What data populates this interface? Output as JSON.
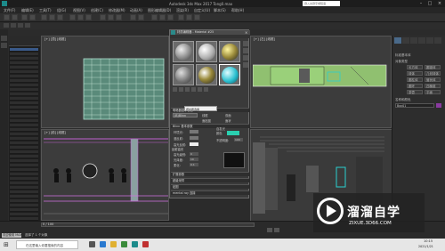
{
  "window": {
    "title": "Autodesk 3ds Max 2017    Tong0.max",
    "search_placeholder": "键入关键字或短语"
  },
  "menubar": {
    "items": [
      "文件(F)",
      "编辑(E)",
      "工具(T)",
      "组(G)",
      "视图(V)",
      "创建(C)",
      "修改器(M)",
      "动画(A)",
      "图形编辑器(D)",
      "渲染(R)",
      "自定义(U)",
      "脚本(S)",
      "帮助(H)"
    ]
  },
  "viewports": {
    "top_left": "[+] [顶] [线框]",
    "bottom_left": "[+] [前] [线框]",
    "top_right": "[+] [左] [线框]",
    "bottom_right": "[+] [透视] [真实]"
  },
  "material_editor": {
    "title": "材质编辑器 - Material #25",
    "slot_colors": [
      "#8a8a8a",
      "#b0b0b0",
      "#9a8a3a",
      "#2ac0d0"
    ],
    "tooltip": "按材质选择",
    "basic_params_header": "明暗器基本参数",
    "shader": "(B)Blinn",
    "options": [
      "线框",
      "双面",
      "面贴图",
      "面状"
    ],
    "blinn_header": "Blinn 基本参数",
    "fields": [
      "环境光:",
      "漫反射:",
      "高光反射:"
    ],
    "self_illum": "自发光",
    "color_label": "颜色",
    "opacity_label": "不透明度:",
    "opacity_value": "100",
    "specular_header": "反射高光",
    "spec_fields": [
      "高光级别:",
      "光泽度:",
      "柔化:"
    ],
    "spec_values": [
      "0",
      "10",
      "0.1"
    ],
    "sections": [
      "扩展参数",
      "超级采样",
      "贴图",
      "mental ray 连接"
    ],
    "accent": "#2ad0b0"
  },
  "right_panel": {
    "title": "标准基本体",
    "object_type": "对象类型",
    "buttons": [
      "长方体",
      "圆锥体",
      "球体",
      "几何球体",
      "圆柱体",
      "管状体",
      "圆环",
      "四棱锥",
      "茶壶",
      "平面"
    ],
    "name_color": "名称和颜色",
    "name_value": "Box01"
  },
  "status": {
    "frame": "0 / 100",
    "welcome": "欢迎使用 MAXSc",
    "selected": "选择了 1 个对象"
  },
  "taskbar": {
    "search": "在这里输入你要搜索的内容",
    "time": "10:15",
    "date": "2021/1/21"
  },
  "watermark": {
    "cn": "溜溜自学",
    "en": "ZIXUE.3D66.COM"
  }
}
